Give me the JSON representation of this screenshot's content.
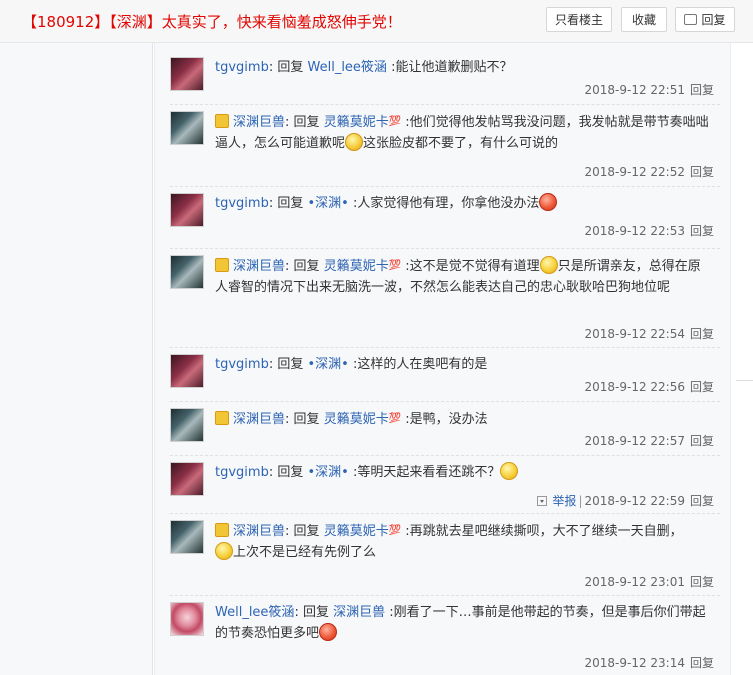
{
  "header": {
    "title": "【180912】【深渊】太真实了，快来看恼羞成怒伸手党！",
    "buttons": {
      "only_host": "只看楼主",
      "favorite": "收藏",
      "reply": "回复"
    }
  },
  "labels": {
    "reply_verb": "回复",
    "reply_link": "回复",
    "report": "举报",
    "separator": "|"
  },
  "comments": [
    {
      "user": "tgvgimb",
      "target": "Well_lee筱涵",
      "text": ":能让他道歉删贴不？",
      "time": "2018-9-12 22:51"
    },
    {
      "user": "深渊巨兽",
      "target": "灵籟莫妮卡",
      "target_badge": "💯",
      "text": ":他们觉得他发帖骂我没问题，我发帖就是带节奏咄咄逼人，怎么可能道歉呢",
      "emoji": "think-emoji",
      "text2": "这张脸皮都不要了，有什么可说的",
      "time": "2018-9-12 22:52"
    },
    {
      "user": "tgvgimb",
      "target": "•深渊•",
      "text": ":人家觉得他有理，你拿他没办法",
      "emoji": "angry-emoji",
      "time": "2018-9-12 22:53"
    },
    {
      "user": "深渊巨兽",
      "target": "灵籟莫妮卡",
      "target_badge": "💯",
      "text": ":这不是觉不觉得有道理",
      "emoji": "smile-emoji",
      "text2": "只是所谓亲友，总得在原人睿智的情况下出来无脑洗一波，不然怎么能表达自己的忠心耿耿哈巴狗地位呢",
      "time": "2018-9-12 22:54"
    },
    {
      "user": "tgvgimb",
      "target": "•深渊•",
      "text": ":这样的人在奥吧有的是",
      "time": "2018-9-12 22:56"
    },
    {
      "user": "深渊巨兽",
      "target": "灵籟莫妮卡",
      "target_badge": "💯",
      "text": ":是鸭，没办法",
      "time": "2018-9-12 22:57"
    },
    {
      "user": "tgvgimb",
      "target": "•深渊•",
      "text": ":等明天起来看看还跳不？",
      "emoji": "smile-emoji",
      "time": "2018-9-12 22:59"
    },
    {
      "user": "深渊巨兽",
      "target": "灵籟莫妮卡",
      "target_badge": "💯",
      "text": ":再跳就去星吧继续撕呗，大不了继续一天自删，",
      "emoji": "smile-emoji",
      "text2": "上次不是已经有先例了么",
      "time": "2018-9-12 23:01"
    },
    {
      "user": "Well_lee筱涵",
      "target": "深渊巨兽",
      "text": ":刚看了一下…事前是他带起的节奏，但是事后你们带起的节奏恐怕更多吧",
      "emoji": "angry-emoji",
      "time": "2018-9-12 23:14"
    }
  ],
  "colors": {
    "title_red": "#e10602",
    "link_blue": "#2d64b3",
    "panel_bg": "#f7f8fa"
  }
}
